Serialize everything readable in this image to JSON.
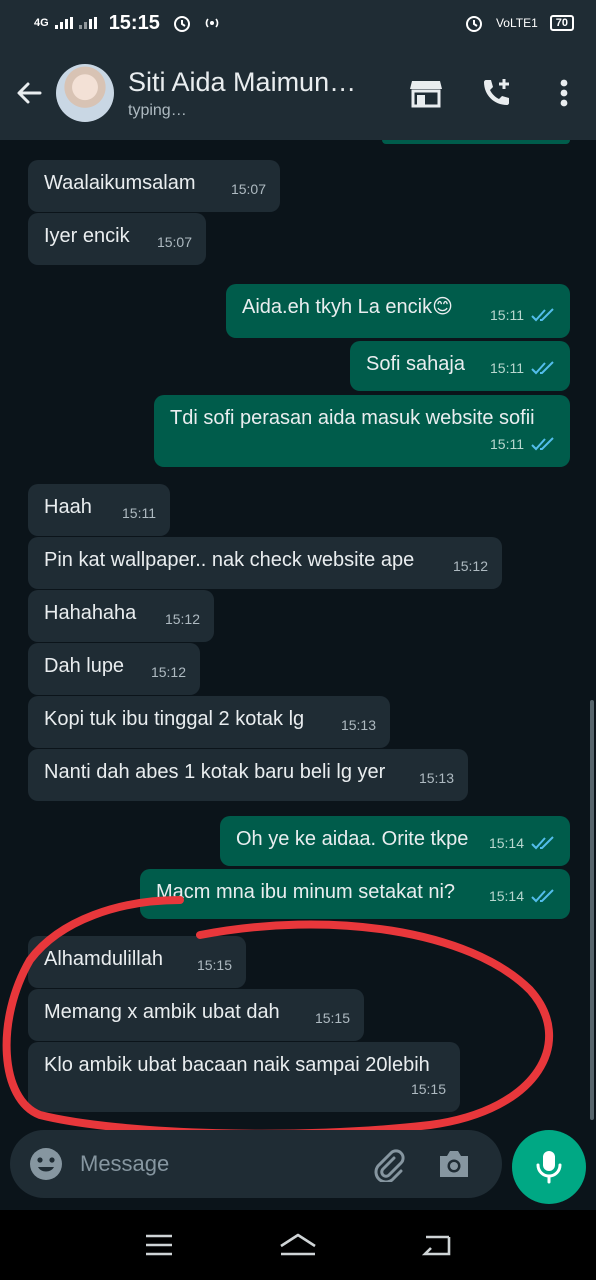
{
  "status_bar": {
    "network": "4G",
    "time": "15:15",
    "volte": "VoLTE1",
    "battery": "70"
  },
  "header": {
    "contact_name": "Siti Aida Maimun…",
    "status": "typing…",
    "icons": [
      "back-arrow-icon",
      "avatar",
      "shop-icon",
      "add-call-icon",
      "more-vert-icon"
    ]
  },
  "messages": [
    {
      "dir": "in",
      "text": "Waalaikumsalam",
      "time": "15:07"
    },
    {
      "dir": "in",
      "text": "Iyer encik",
      "time": "15:07"
    },
    {
      "dir": "out",
      "text": "Aida.eh tkyh La encik😊",
      "time": "15:11",
      "read": true
    },
    {
      "dir": "out",
      "text": "Sofi sahaja",
      "time": "15:11",
      "read": true
    },
    {
      "dir": "out",
      "text": "Tdi sofi perasan aida masuk website sofii",
      "time": "15:11",
      "read": true
    },
    {
      "dir": "in",
      "text": "Haah",
      "time": "15:11"
    },
    {
      "dir": "in",
      "text": "Pin kat wallpaper.. nak check website ape",
      "time": "15:12"
    },
    {
      "dir": "in",
      "text": "Hahahaha",
      "time": "15:12"
    },
    {
      "dir": "in",
      "text": "Dah lupe",
      "time": "15:12"
    },
    {
      "dir": "in",
      "text": "Kopi tuk ibu tinggal 2 kotak lg",
      "time": "15:13"
    },
    {
      "dir": "in",
      "text": "Nanti dah abes 1 kotak baru beli lg yer",
      "time": "15:13"
    },
    {
      "dir": "out",
      "text": "Oh ye ke aidaa. Orite tkpe",
      "time": "15:14",
      "read": true
    },
    {
      "dir": "out",
      "text": "Macm mna ibu minum setakat ni?",
      "time": "15:14",
      "read": true
    },
    {
      "dir": "in",
      "text": "Alhamdulillah",
      "time": "15:15"
    },
    {
      "dir": "in",
      "text": "Memang x ambik ubat dah",
      "time": "15:15"
    },
    {
      "dir": "in",
      "text": "Klo ambik ubat bacaan naik sampai 20lebih",
      "time": "15:15"
    }
  ],
  "composer": {
    "placeholder": "Message"
  },
  "colors": {
    "background": "#0b141a",
    "incoming_bubble": "#1f2c34",
    "outgoing_bubble": "#005c4b",
    "accent": "#00a884",
    "read_tick": "#53bdeb",
    "annotation": "#e8373b"
  }
}
